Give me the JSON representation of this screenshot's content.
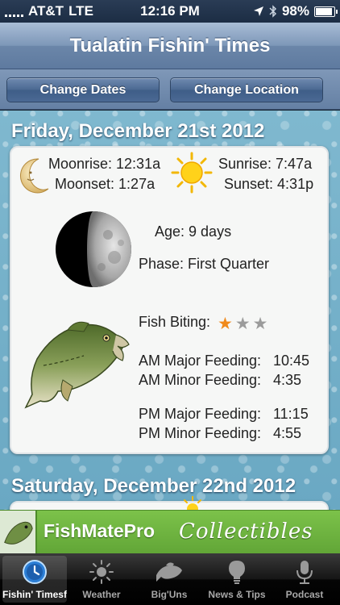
{
  "status_bar": {
    "carrier": "AT&T",
    "network": "LTE",
    "time": "12:16 PM",
    "battery": "98%",
    "battery_level": 0.98
  },
  "app": {
    "title": "Tualatin Fishin' Times"
  },
  "toolbar": {
    "change_dates_label": "Change Dates",
    "change_location_label": "Change Location"
  },
  "days": [
    {
      "date": "Friday, December 21st 2012",
      "moonrise": "Moonrise: 12:31a",
      "moonset": "Moonset: 1:27a",
      "sunrise": "Sunrise: 7:47a",
      "sunset": "Sunset: 4:31p",
      "moon_age": "Age: 9 days",
      "moon_phase": "Phase: First Quarter",
      "fish_biting_label": "Fish Biting:",
      "fish_biting_rating": 1,
      "fish_biting_max": 3,
      "am_major": "AM Major Feeding:",
      "am_major_time": "10:45",
      "am_minor": "AM Minor Feeding:",
      "am_minor_time": "4:35",
      "pm_major": "PM Major Feeding:",
      "pm_major_time": "11:15",
      "pm_minor": "PM Minor Feeding:",
      "pm_minor_time": "4:55"
    },
    {
      "date": "Saturday, December 22nd 2012"
    }
  ],
  "ad": {
    "brand": "FishMatePro",
    "tagline": "Collectibles"
  },
  "tabs": [
    {
      "label": "Fishin' Timesf",
      "icon": "clock-icon",
      "active": true
    },
    {
      "label": "Weather",
      "icon": "sun-icon",
      "active": false
    },
    {
      "label": "Big'Uns",
      "icon": "fish-icon",
      "active": false
    },
    {
      "label": "News & Tips",
      "icon": "lightbulb-icon",
      "active": false
    },
    {
      "label": "Podcast",
      "icon": "microphone-icon",
      "active": false
    }
  ],
  "colors": {
    "nav_blue": "#6b86a9",
    "star_active": "#f08a1c",
    "star_inactive": "#9b9b9b",
    "ad_green": "#6aae3c",
    "tab_active": "#2c7fd6"
  }
}
